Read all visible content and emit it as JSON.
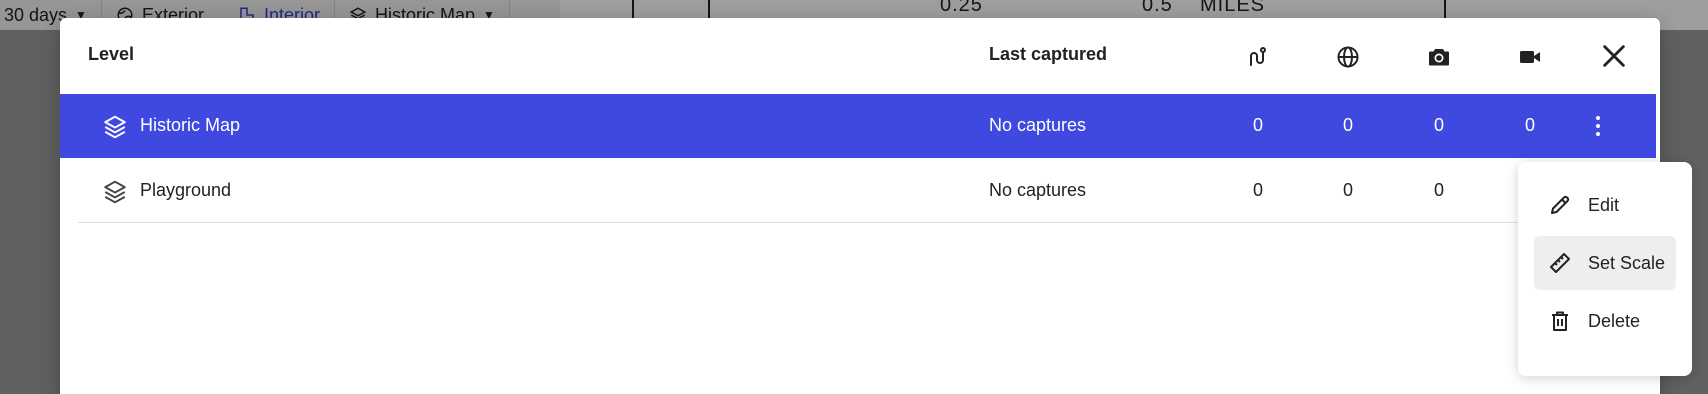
{
  "background": {
    "date_range": "30 days",
    "tabs": [
      "Exterior",
      "Interior"
    ],
    "level_select": "Historic Map",
    "map_labels": [
      "0.25",
      "0.5",
      "MILES"
    ]
  },
  "modal": {
    "columns": {
      "level": "Level",
      "last_captured": "Last captured",
      "icons": [
        "route-icon",
        "globe-icon",
        "camera-icon",
        "video-camera-icon"
      ]
    },
    "rows": [
      {
        "name": "Historic Map",
        "last_captured": "No captures",
        "counts": [
          "0",
          "0",
          "0",
          "0"
        ],
        "selected": true
      },
      {
        "name": "Playground",
        "last_captured": "No captures",
        "counts": [
          "0",
          "0",
          "0"
        ],
        "selected": false
      }
    ],
    "menu": {
      "items": [
        {
          "label": "Edit",
          "icon": "pencil-icon"
        },
        {
          "label": "Set Scale",
          "icon": "ruler-icon",
          "hovered": true
        },
        {
          "label": "Delete",
          "icon": "trash-icon"
        }
      ]
    }
  },
  "colors": {
    "selected_row": "#3f49e0",
    "accent": "#3b3fcf"
  }
}
